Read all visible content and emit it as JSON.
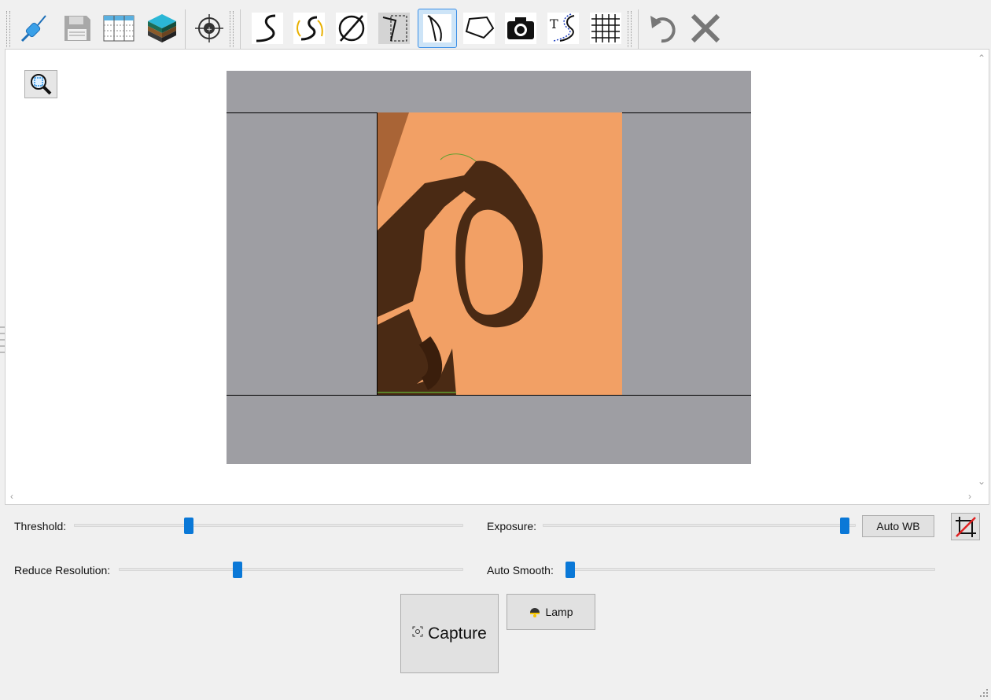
{
  "toolbar": {
    "icons": [
      "pen-probe-icon",
      "save-icon",
      "table-icon",
      "layers-icon",
      "target-icon",
      "s-curve-icon",
      "auto-curve-icon",
      "diameter-icon",
      "select-region-icon",
      "trace-outline-icon",
      "polygon-icon",
      "camera-icon",
      "text-curve-icon",
      "grid-icon",
      "undo-icon",
      "close-icon"
    ],
    "active_tool": "trace-outline-icon"
  },
  "controls": {
    "threshold_label": "Threshold:",
    "threshold_value": 0.29,
    "exposure_label": "Exposure:",
    "exposure_value": 0.98,
    "auto_wb_label": "Auto WB",
    "reduce_resolution_label": "Reduce Resolution:",
    "reduce_resolution_value": 0.34,
    "auto_smooth_label": "Auto Smooth:",
    "auto_smooth_value": 0.0,
    "capture_label": "Capture",
    "lamp_label": "Lamp"
  },
  "colors": {
    "accent": "#0a78d7",
    "photo_background": "#f2a065",
    "object": "#4a2a14"
  }
}
